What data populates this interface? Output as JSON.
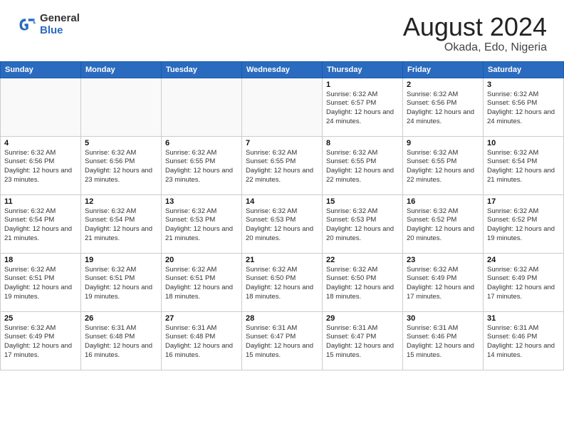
{
  "logo": {
    "general": "General",
    "blue": "Blue"
  },
  "title": "August 2024",
  "location": "Okada, Edo, Nigeria",
  "headers": [
    "Sunday",
    "Monday",
    "Tuesday",
    "Wednesday",
    "Thursday",
    "Friday",
    "Saturday"
  ],
  "weeks": [
    [
      {
        "day": "",
        "info": ""
      },
      {
        "day": "",
        "info": ""
      },
      {
        "day": "",
        "info": ""
      },
      {
        "day": "",
        "info": ""
      },
      {
        "day": "1",
        "info": "Sunrise: 6:32 AM\nSunset: 6:57 PM\nDaylight: 12 hours\nand 24 minutes."
      },
      {
        "day": "2",
        "info": "Sunrise: 6:32 AM\nSunset: 6:56 PM\nDaylight: 12 hours\nand 24 minutes."
      },
      {
        "day": "3",
        "info": "Sunrise: 6:32 AM\nSunset: 6:56 PM\nDaylight: 12 hours\nand 24 minutes."
      }
    ],
    [
      {
        "day": "4",
        "info": "Sunrise: 6:32 AM\nSunset: 6:56 PM\nDaylight: 12 hours\nand 23 minutes."
      },
      {
        "day": "5",
        "info": "Sunrise: 6:32 AM\nSunset: 6:56 PM\nDaylight: 12 hours\nand 23 minutes."
      },
      {
        "day": "6",
        "info": "Sunrise: 6:32 AM\nSunset: 6:55 PM\nDaylight: 12 hours\nand 23 minutes."
      },
      {
        "day": "7",
        "info": "Sunrise: 6:32 AM\nSunset: 6:55 PM\nDaylight: 12 hours\nand 22 minutes."
      },
      {
        "day": "8",
        "info": "Sunrise: 6:32 AM\nSunset: 6:55 PM\nDaylight: 12 hours\nand 22 minutes."
      },
      {
        "day": "9",
        "info": "Sunrise: 6:32 AM\nSunset: 6:55 PM\nDaylight: 12 hours\nand 22 minutes."
      },
      {
        "day": "10",
        "info": "Sunrise: 6:32 AM\nSunset: 6:54 PM\nDaylight: 12 hours\nand 21 minutes."
      }
    ],
    [
      {
        "day": "11",
        "info": "Sunrise: 6:32 AM\nSunset: 6:54 PM\nDaylight: 12 hours\nand 21 minutes."
      },
      {
        "day": "12",
        "info": "Sunrise: 6:32 AM\nSunset: 6:54 PM\nDaylight: 12 hours\nand 21 minutes."
      },
      {
        "day": "13",
        "info": "Sunrise: 6:32 AM\nSunset: 6:53 PM\nDaylight: 12 hours\nand 21 minutes."
      },
      {
        "day": "14",
        "info": "Sunrise: 6:32 AM\nSunset: 6:53 PM\nDaylight: 12 hours\nand 20 minutes."
      },
      {
        "day": "15",
        "info": "Sunrise: 6:32 AM\nSunset: 6:53 PM\nDaylight: 12 hours\nand 20 minutes."
      },
      {
        "day": "16",
        "info": "Sunrise: 6:32 AM\nSunset: 6:52 PM\nDaylight: 12 hours\nand 20 minutes."
      },
      {
        "day": "17",
        "info": "Sunrise: 6:32 AM\nSunset: 6:52 PM\nDaylight: 12 hours\nand 19 minutes."
      }
    ],
    [
      {
        "day": "18",
        "info": "Sunrise: 6:32 AM\nSunset: 6:51 PM\nDaylight: 12 hours\nand 19 minutes."
      },
      {
        "day": "19",
        "info": "Sunrise: 6:32 AM\nSunset: 6:51 PM\nDaylight: 12 hours\nand 19 minutes."
      },
      {
        "day": "20",
        "info": "Sunrise: 6:32 AM\nSunset: 6:51 PM\nDaylight: 12 hours\nand 18 minutes."
      },
      {
        "day": "21",
        "info": "Sunrise: 6:32 AM\nSunset: 6:50 PM\nDaylight: 12 hours\nand 18 minutes."
      },
      {
        "day": "22",
        "info": "Sunrise: 6:32 AM\nSunset: 6:50 PM\nDaylight: 12 hours\nand 18 minutes."
      },
      {
        "day": "23",
        "info": "Sunrise: 6:32 AM\nSunset: 6:49 PM\nDaylight: 12 hours\nand 17 minutes."
      },
      {
        "day": "24",
        "info": "Sunrise: 6:32 AM\nSunset: 6:49 PM\nDaylight: 12 hours\nand 17 minutes."
      }
    ],
    [
      {
        "day": "25",
        "info": "Sunrise: 6:32 AM\nSunset: 6:49 PM\nDaylight: 12 hours\nand 17 minutes."
      },
      {
        "day": "26",
        "info": "Sunrise: 6:31 AM\nSunset: 6:48 PM\nDaylight: 12 hours\nand 16 minutes."
      },
      {
        "day": "27",
        "info": "Sunrise: 6:31 AM\nSunset: 6:48 PM\nDaylight: 12 hours\nand 16 minutes."
      },
      {
        "day": "28",
        "info": "Sunrise: 6:31 AM\nSunset: 6:47 PM\nDaylight: 12 hours\nand 15 minutes."
      },
      {
        "day": "29",
        "info": "Sunrise: 6:31 AM\nSunset: 6:47 PM\nDaylight: 12 hours\nand 15 minutes."
      },
      {
        "day": "30",
        "info": "Sunrise: 6:31 AM\nSunset: 6:46 PM\nDaylight: 12 hours\nand 15 minutes."
      },
      {
        "day": "31",
        "info": "Sunrise: 6:31 AM\nSunset: 6:46 PM\nDaylight: 12 hours\nand 14 minutes."
      }
    ]
  ]
}
